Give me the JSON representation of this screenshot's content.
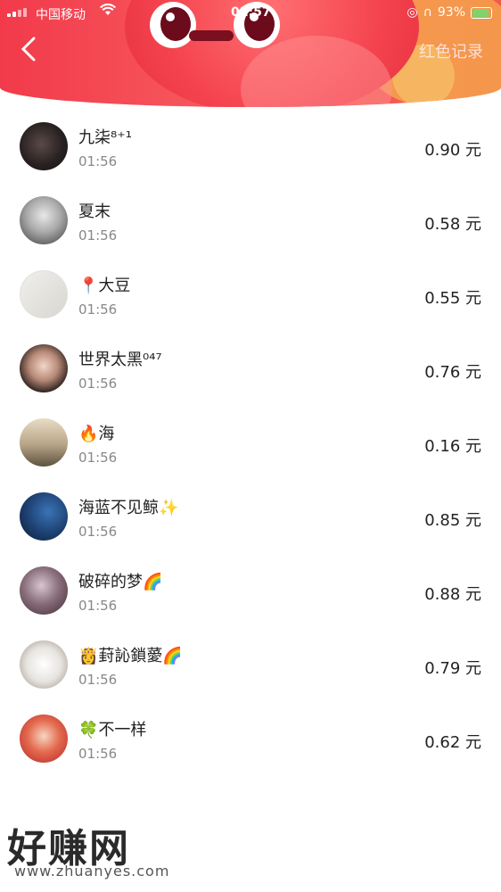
{
  "status_bar": {
    "carrier": "中国移动",
    "time": "01:57",
    "battery": "93%"
  },
  "header": {
    "records_label": "红色记录"
  },
  "colors": {
    "header_red": "#f23a4b",
    "mascot_red": "#f4434f",
    "text_dark": "#222222",
    "text_muted": "#888888"
  },
  "entries": [
    {
      "name": "九柒⁸⁺¹",
      "time": "01:56",
      "amount": "0.90 元"
    },
    {
      "name": "夏末",
      "time": "01:56",
      "amount": "0.58 元"
    },
    {
      "name": "📍大豆",
      "time": "01:56",
      "amount": "0.55 元"
    },
    {
      "name": "世界太黑⁰⁴⁷",
      "time": "01:56",
      "amount": "0.76 元"
    },
    {
      "name": "🔥海",
      "time": "01:56",
      "amount": "0.16 元"
    },
    {
      "name": "海蓝不见鲸✨",
      "time": "01:56",
      "amount": "0.85 元"
    },
    {
      "name": "破碎的梦🌈",
      "time": "01:56",
      "amount": "0.88 元"
    },
    {
      "name": "👸葑訫鎖薆🌈",
      "time": "01:56",
      "amount": "0.79 元"
    },
    {
      "name": "🍀不一样",
      "time": "01:56",
      "amount": "0.62 元"
    }
  ],
  "watermark": {
    "title": "好赚网",
    "url": "www.zhuanyes.com"
  }
}
